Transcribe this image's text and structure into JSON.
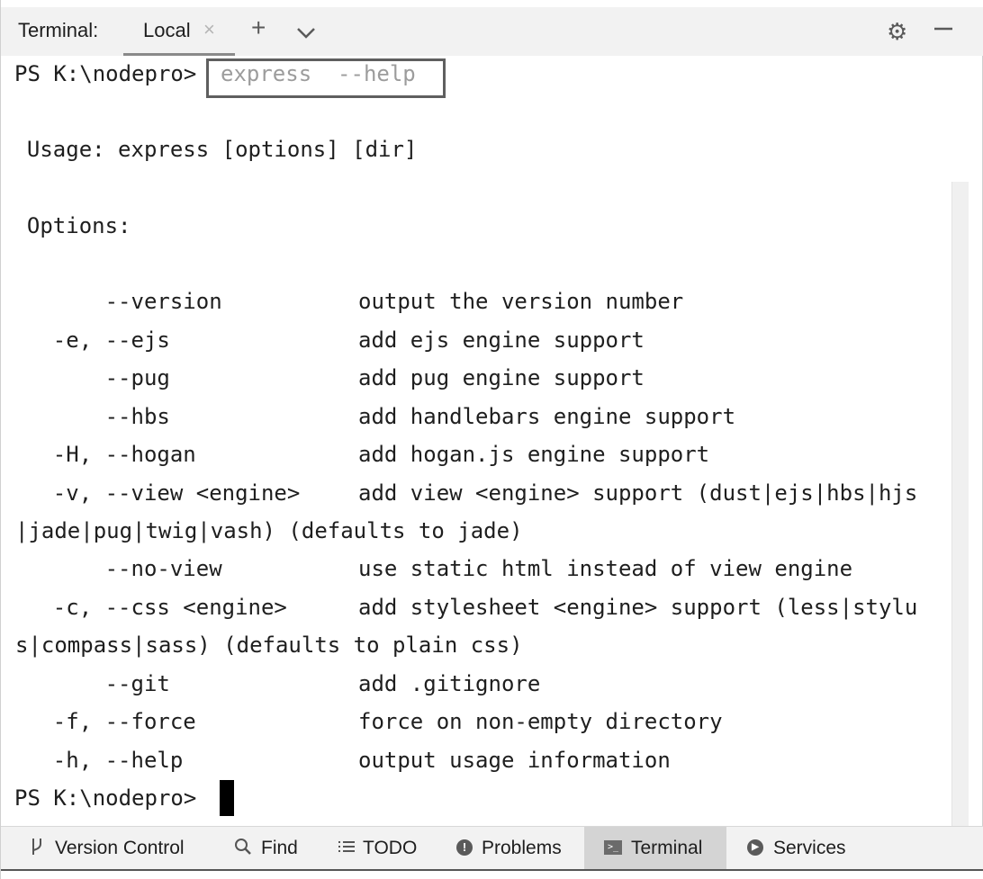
{
  "header": {
    "title": "Terminal:",
    "tab_label": "Local",
    "tab_close": "×",
    "add": "+",
    "chevron": "⌄",
    "gear": "⚙",
    "minimize": "—"
  },
  "terminal": {
    "prompt": "PS K:\\nodepro>",
    "command": "express  --help",
    "usage": "  Usage: express [options] [dir]",
    "options_heading": "  Options:",
    "options": [
      {
        "flag": "        --version",
        "desc": "output the version number"
      },
      {
        "flag": "    -e, --ejs",
        "desc": "add ejs engine support"
      },
      {
        "flag": "        --pug",
        "desc": "add pug engine support"
      },
      {
        "flag": "        --hbs",
        "desc": "add handlebars engine support"
      },
      {
        "flag": "    -H, --hogan",
        "desc": "add hogan.js engine support"
      },
      {
        "flag": "    -v, --view <engine>",
        "desc": "add view <engine> support (dust|ejs|hbs|hjs"
      },
      {
        "flag": "|jade|pug|twig|vash) (defaults to jade)",
        "desc": ""
      },
      {
        "flag": "        --no-view",
        "desc": "use static html instead of view engine"
      },
      {
        "flag": "    -c, --css <engine>",
        "desc": "add stylesheet <engine> support (less|stylu"
      },
      {
        "flag": "s|compass|sass) (defaults to plain css)",
        "desc": ""
      },
      {
        "flag": "        --git",
        "desc": "add .gitignore"
      },
      {
        "flag": "    -f, --force",
        "desc": "force on non-empty directory"
      },
      {
        "flag": "    -h, --help",
        "desc": "output usage information"
      }
    ],
    "final_prompt": "PS K:\\nodepro>"
  },
  "toolbar": {
    "version_control": "Version Control",
    "find": "Find",
    "todo": "TODO",
    "problems": "Problems",
    "terminal": "Terminal",
    "services": "Services"
  }
}
